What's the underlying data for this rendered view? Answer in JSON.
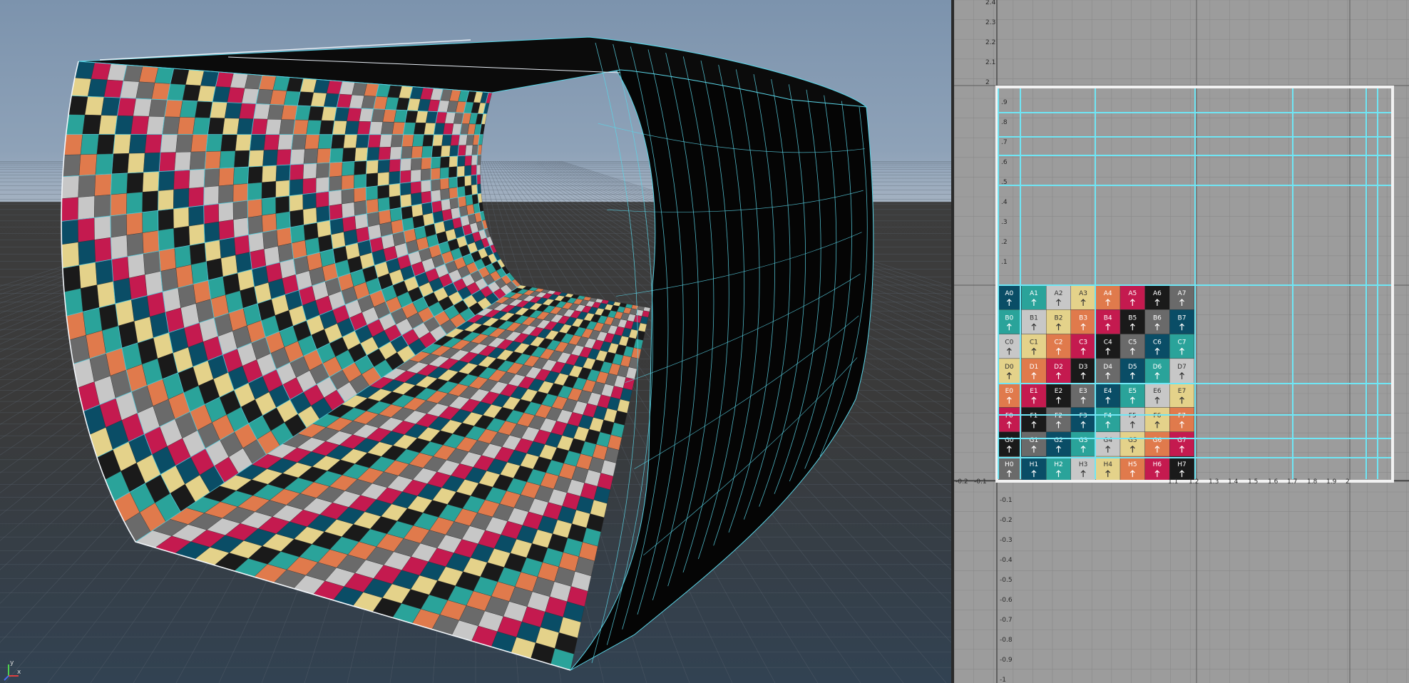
{
  "palette": [
    "#0a4d66",
    "#2aa39a",
    "#c7c7c7",
    "#e4d28a",
    "#e07a4c",
    "#c41a4f",
    "#1a1a1a",
    "#6a6a6a"
  ],
  "colors": {
    "wire": "#5ad6e8",
    "wireBright": "#6fe6f5",
    "uvBorder": "#f2f2f2",
    "uvGridLine": "#7a7a7a",
    "tubeBlack": "#050505"
  },
  "uv_rows": [
    "A",
    "B",
    "C",
    "D",
    "E",
    "F",
    "G",
    "H"
  ],
  "uv_cols": [
    "0",
    "1",
    "2",
    "3",
    "4",
    "5",
    "6",
    "7"
  ],
  "uv_axis": {
    "top_labels": [
      "2.4",
      "2.3",
      "2.2",
      "2.1",
      "2"
    ],
    "left_labels": [
      ".9",
      ".8",
      ".7",
      ".6",
      ".5",
      ".4",
      ".3",
      ".2",
      ".1"
    ],
    "bottom_labels": [
      "-0.2",
      "-0.1",
      "1.1",
      "1.2",
      "1.3",
      "1.4",
      "1.5",
      "1.6",
      "1.7",
      "1.8",
      "1.9",
      "2"
    ],
    "neg_labels": [
      "-0.1",
      "-0.2",
      "-0.3",
      "-0.4",
      "-0.5",
      "-0.6",
      "-0.7",
      "-0.8",
      "-0.9",
      "-1"
    ]
  },
  "axis_gizmo": {
    "x": "x",
    "y": "y"
  }
}
